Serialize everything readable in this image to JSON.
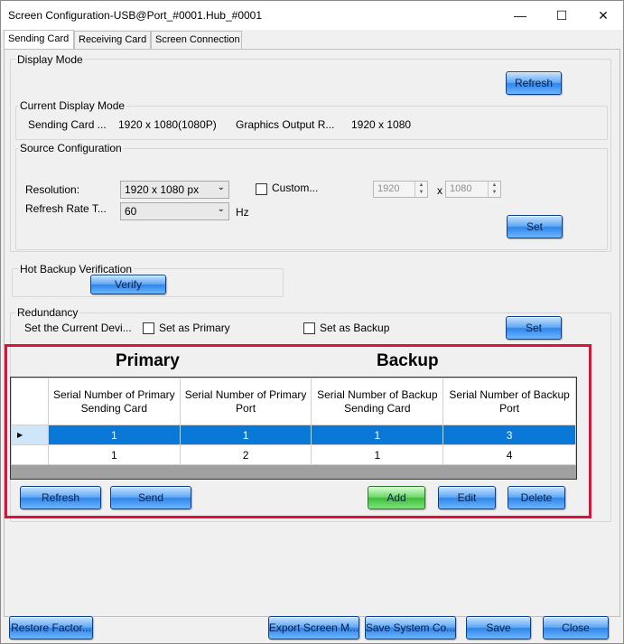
{
  "window": {
    "title": "Screen Configuration-USB@Port_#0001.Hub_#0001",
    "minimize_glyph": "—",
    "maximize_glyph": "☐",
    "close_glyph": "✕"
  },
  "tabs": [
    {
      "label": "Sending Card",
      "active": true
    },
    {
      "label": "Receiving Card",
      "active": false
    },
    {
      "label": "Screen Connection",
      "active": false
    }
  ],
  "display_mode": {
    "title": "Display Mode",
    "refresh_label": "Refresh",
    "current_title": "Current Display Mode",
    "sending_card_label": "Sending Card ...",
    "sending_card_value": "1920 x 1080(1080P)",
    "graphics_label": "Graphics Output R...",
    "graphics_value": "1920 x 1080"
  },
  "source_config": {
    "title": "Source Configuration",
    "resolution_label": "Resolution:",
    "resolution_value": "1920 x 1080 px",
    "custom_label": "Custom...",
    "custom_checked": false,
    "width_value": "1920",
    "x_label": "x",
    "height_value": "1080",
    "refresh_rate_label": "Refresh Rate T...",
    "refresh_rate_value": "60",
    "hz_label": "Hz",
    "set_label": "Set"
  },
  "hot_backup": {
    "title": "Hot Backup Verification",
    "verify_label": "Verify"
  },
  "redundancy": {
    "title": "Redundancy",
    "set_current_label": "Set the Current Devi...",
    "primary_label": "Set as Primary",
    "primary_checked": false,
    "backup_label": "Set as Backup",
    "backup_checked": false,
    "set_label": "Set",
    "primary_heading": "Primary",
    "backup_heading": "Backup",
    "columns": [
      "Serial Number of Primary Sending Card",
      "Serial Number of Primary Port",
      "Serial Number of Backup Sending Card",
      "Serial Number of Backup Port"
    ],
    "row_indicator": "▶",
    "rows": [
      {
        "cells": [
          "1",
          "1",
          "1",
          "3"
        ],
        "selected": true
      },
      {
        "cells": [
          "1",
          "2",
          "1",
          "4"
        ],
        "selected": false
      }
    ],
    "refresh_label": "Refresh",
    "send_label": "Send",
    "add_label": "Add",
    "edit_label": "Edit",
    "delete_label": "Delete"
  },
  "footer": {
    "restore_label": "Restore Factor...",
    "export_label": "Export Screen M...",
    "save_system_label": "Save System Co...",
    "save_label": "Save",
    "close_label": "Close"
  },
  "colors": {
    "selected_row": "#0a78d7",
    "highlight_border": "#e0103a",
    "button_blue": "#2f85ea",
    "button_green": "#3dbf3a"
  }
}
